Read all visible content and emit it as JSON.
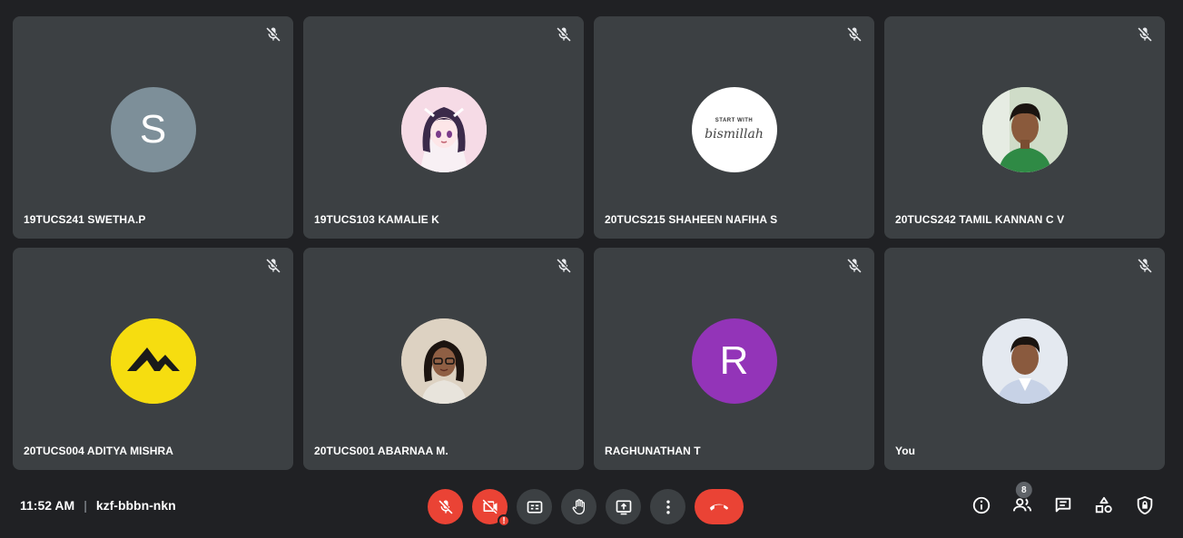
{
  "participants": [
    {
      "name": "19TUCS241 SWETHA.P",
      "avatar_type": "letter",
      "letter": "S",
      "color": "#7d8f99"
    },
    {
      "name": "19TUCS103 KAMALIE K",
      "avatar_type": "photo",
      "icon": "anime-avatar"
    },
    {
      "name": "20TUCS215 SHAHEEN NAFIHA S",
      "avatar_type": "photo",
      "icon": "bismillah-avatar",
      "avatar_text_top": "START WITH",
      "avatar_text_main": "bismillah"
    },
    {
      "name": "20TUCS242 TAMIL KANNAN C V",
      "avatar_type": "photo",
      "icon": "person-avatar"
    },
    {
      "name": "20TUCS004 ADITYA MISHRA",
      "avatar_type": "photo",
      "icon": "mountain-logo-avatar"
    },
    {
      "name": "20TUCS001 ABARNAA M.",
      "avatar_type": "photo",
      "icon": "person-glasses-avatar"
    },
    {
      "name": "RAGHUNATHAN T",
      "avatar_type": "letter",
      "letter": "R",
      "color": "#9334b8"
    },
    {
      "name": "You",
      "avatar_type": "photo",
      "icon": "person-avatar"
    }
  ],
  "meeting": {
    "time": "11:52 AM",
    "separator": "|",
    "code": "kzf-bbbn-nkn"
  },
  "controls": [
    {
      "name": "mic-off-button",
      "icon": "mic-off-icon"
    },
    {
      "name": "camera-off-button",
      "icon": "camera-off-icon",
      "badge": "!"
    },
    {
      "name": "captions-button",
      "icon": "cc-icon"
    },
    {
      "name": "raise-hand-button",
      "icon": "hand-icon"
    },
    {
      "name": "present-button",
      "icon": "present-icon"
    },
    {
      "name": "more-options-button",
      "icon": "more-vert-icon"
    },
    {
      "name": "end-call-button",
      "icon": "phone-hangup-icon"
    }
  ],
  "right_panel": {
    "people_count": "8"
  },
  "colors": {
    "background": "#202124",
    "tile": "#3c4043",
    "red": "#ea4335"
  }
}
